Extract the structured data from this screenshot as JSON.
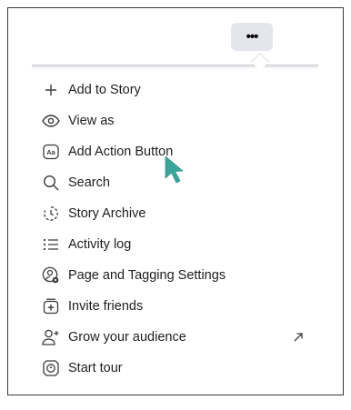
{
  "more_button": {
    "label": "•••"
  },
  "menu": {
    "items": [
      {
        "label": "Add to Story",
        "icon": "plus-icon"
      },
      {
        "label": "View as",
        "icon": "eye-icon"
      },
      {
        "label": "Add Action Button",
        "icon": "action-button-icon"
      },
      {
        "label": "Search",
        "icon": "search-icon"
      },
      {
        "label": "Story Archive",
        "icon": "story-archive-icon"
      },
      {
        "label": "Activity log",
        "icon": "list-icon"
      },
      {
        "label": "Page and Tagging Settings",
        "icon": "person-settings-icon"
      },
      {
        "label": "Invite friends",
        "icon": "invite-icon"
      },
      {
        "label": "Grow your audience",
        "icon": "add-person-icon",
        "external": "external-arrow-icon"
      },
      {
        "label": "Start tour",
        "icon": "tour-icon"
      }
    ]
  },
  "cursor": {
    "icon": "mouse-pointer-icon",
    "color": "#3aa69a"
  }
}
